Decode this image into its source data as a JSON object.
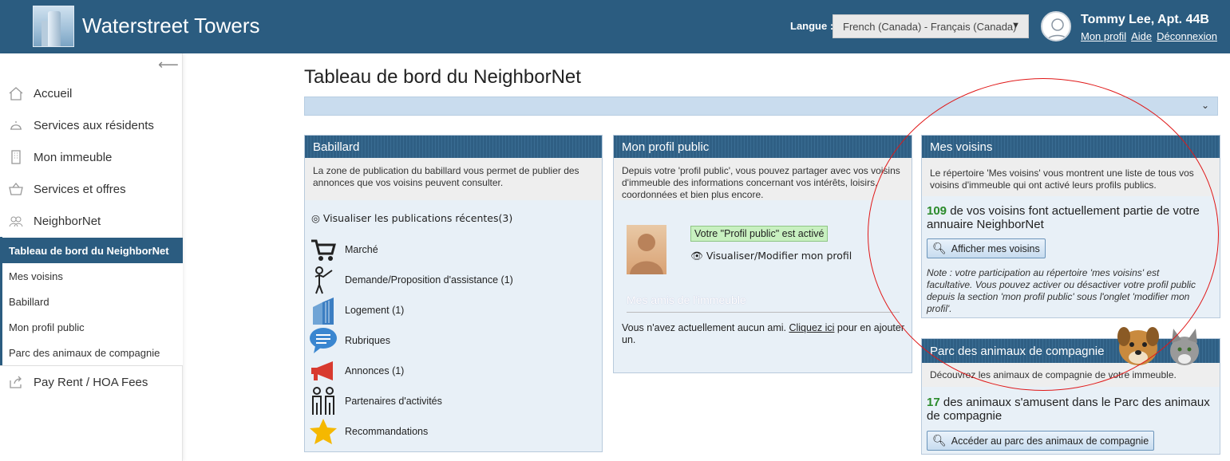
{
  "header": {
    "brand": "Waterstreet Towers",
    "lang_label": "Langue :",
    "lang_value": "French (Canada) - Français (Canada)",
    "user_name": "Tommy Lee, Apt. 44B",
    "links": [
      "Mon profil",
      "Aide",
      "Déconnexion"
    ]
  },
  "sidebar": {
    "items": [
      {
        "label": "Accueil",
        "icon": "home-icon"
      },
      {
        "label": "Services aux résidents",
        "icon": "bell-icon"
      },
      {
        "label": "Mon immeuble",
        "icon": "building-icon"
      },
      {
        "label": "Services et offres",
        "icon": "basket-icon"
      },
      {
        "label": "NeighborNet",
        "icon": "people-icon"
      }
    ],
    "sub_items": [
      "Tableau de bord du NeighborNet",
      "Mes voisins",
      "Babillard",
      "Mon profil public",
      "Parc des animaux de compagnie"
    ],
    "last_item": {
      "label": "Pay Rent / HOA Fees",
      "icon": "share-icon"
    }
  },
  "main": {
    "title": "Tableau de bord du NeighborNet"
  },
  "babillard": {
    "title": "Babillard",
    "desc": "La zone de publication du babillard vous permet de publier des annonces que vos voisins peuvent consulter.",
    "recent_link": "Visualiser les publications récentes(3)",
    "categories": [
      {
        "label": "Marché",
        "icon": "cart-icon"
      },
      {
        "label": "Demande/Proposition d'assistance (1)",
        "icon": "assist-icon"
      },
      {
        "label": "Logement (1)",
        "icon": "housing-icon"
      },
      {
        "label": "Rubriques",
        "icon": "speech-bubble-icon"
      },
      {
        "label": "Annonces (1)",
        "icon": "megaphone-icon"
      },
      {
        "label": "Partenaires d'activités",
        "icon": "partners-icon"
      },
      {
        "label": "Recommandations",
        "icon": "star-icon"
      }
    ]
  },
  "profil": {
    "title": "Mon profil public",
    "desc": "Depuis votre 'profil public', vous pouvez partager avec vos voisins d'immeuble des informations concernant vos intérêts, loisirs, coordonnées et bien plus encore.",
    "badge": "Votre \"Profil public\" est activé",
    "view_link": "Visualiser/Modifier mon profil",
    "friends_title": "Mes amis de l'immeuble",
    "friends_text_pre": "Vous n'avez actuellement aucun ami. ",
    "friends_link": "Cliquez ici",
    "friends_text_post": " pour en ajouter un."
  },
  "voisins": {
    "title": "Mes voisins",
    "desc": "Le répertoire 'Mes voisins' vous montrent une liste de tous vos voisins d'immeuble qui ont activé leurs profils publics.",
    "count": "109",
    "count_text": " de vos voisins font actuellement partie de votre annuaire NeighborNet",
    "button": "Afficher mes voisins",
    "note": "Note : votre participation au répertoire 'mes voisins' est facultative. Vous pouvez activer ou désactiver votre profil public depuis la section 'mon profil public' sous l'onglet 'modifier mon profil'."
  },
  "animaux": {
    "title": "Parc des animaux de compagnie",
    "desc": "Découvrez les animaux de compagnie de votre immeuble.",
    "count": "17",
    "count_text": " des animaux s'amusent dans le Parc des animaux de compagnie",
    "button": "Accéder au parc des animaux de compagnie"
  },
  "colors": {
    "brand": "#2b5c80",
    "count_green": "#2a8a2a",
    "annotation_red": "#e01818"
  }
}
